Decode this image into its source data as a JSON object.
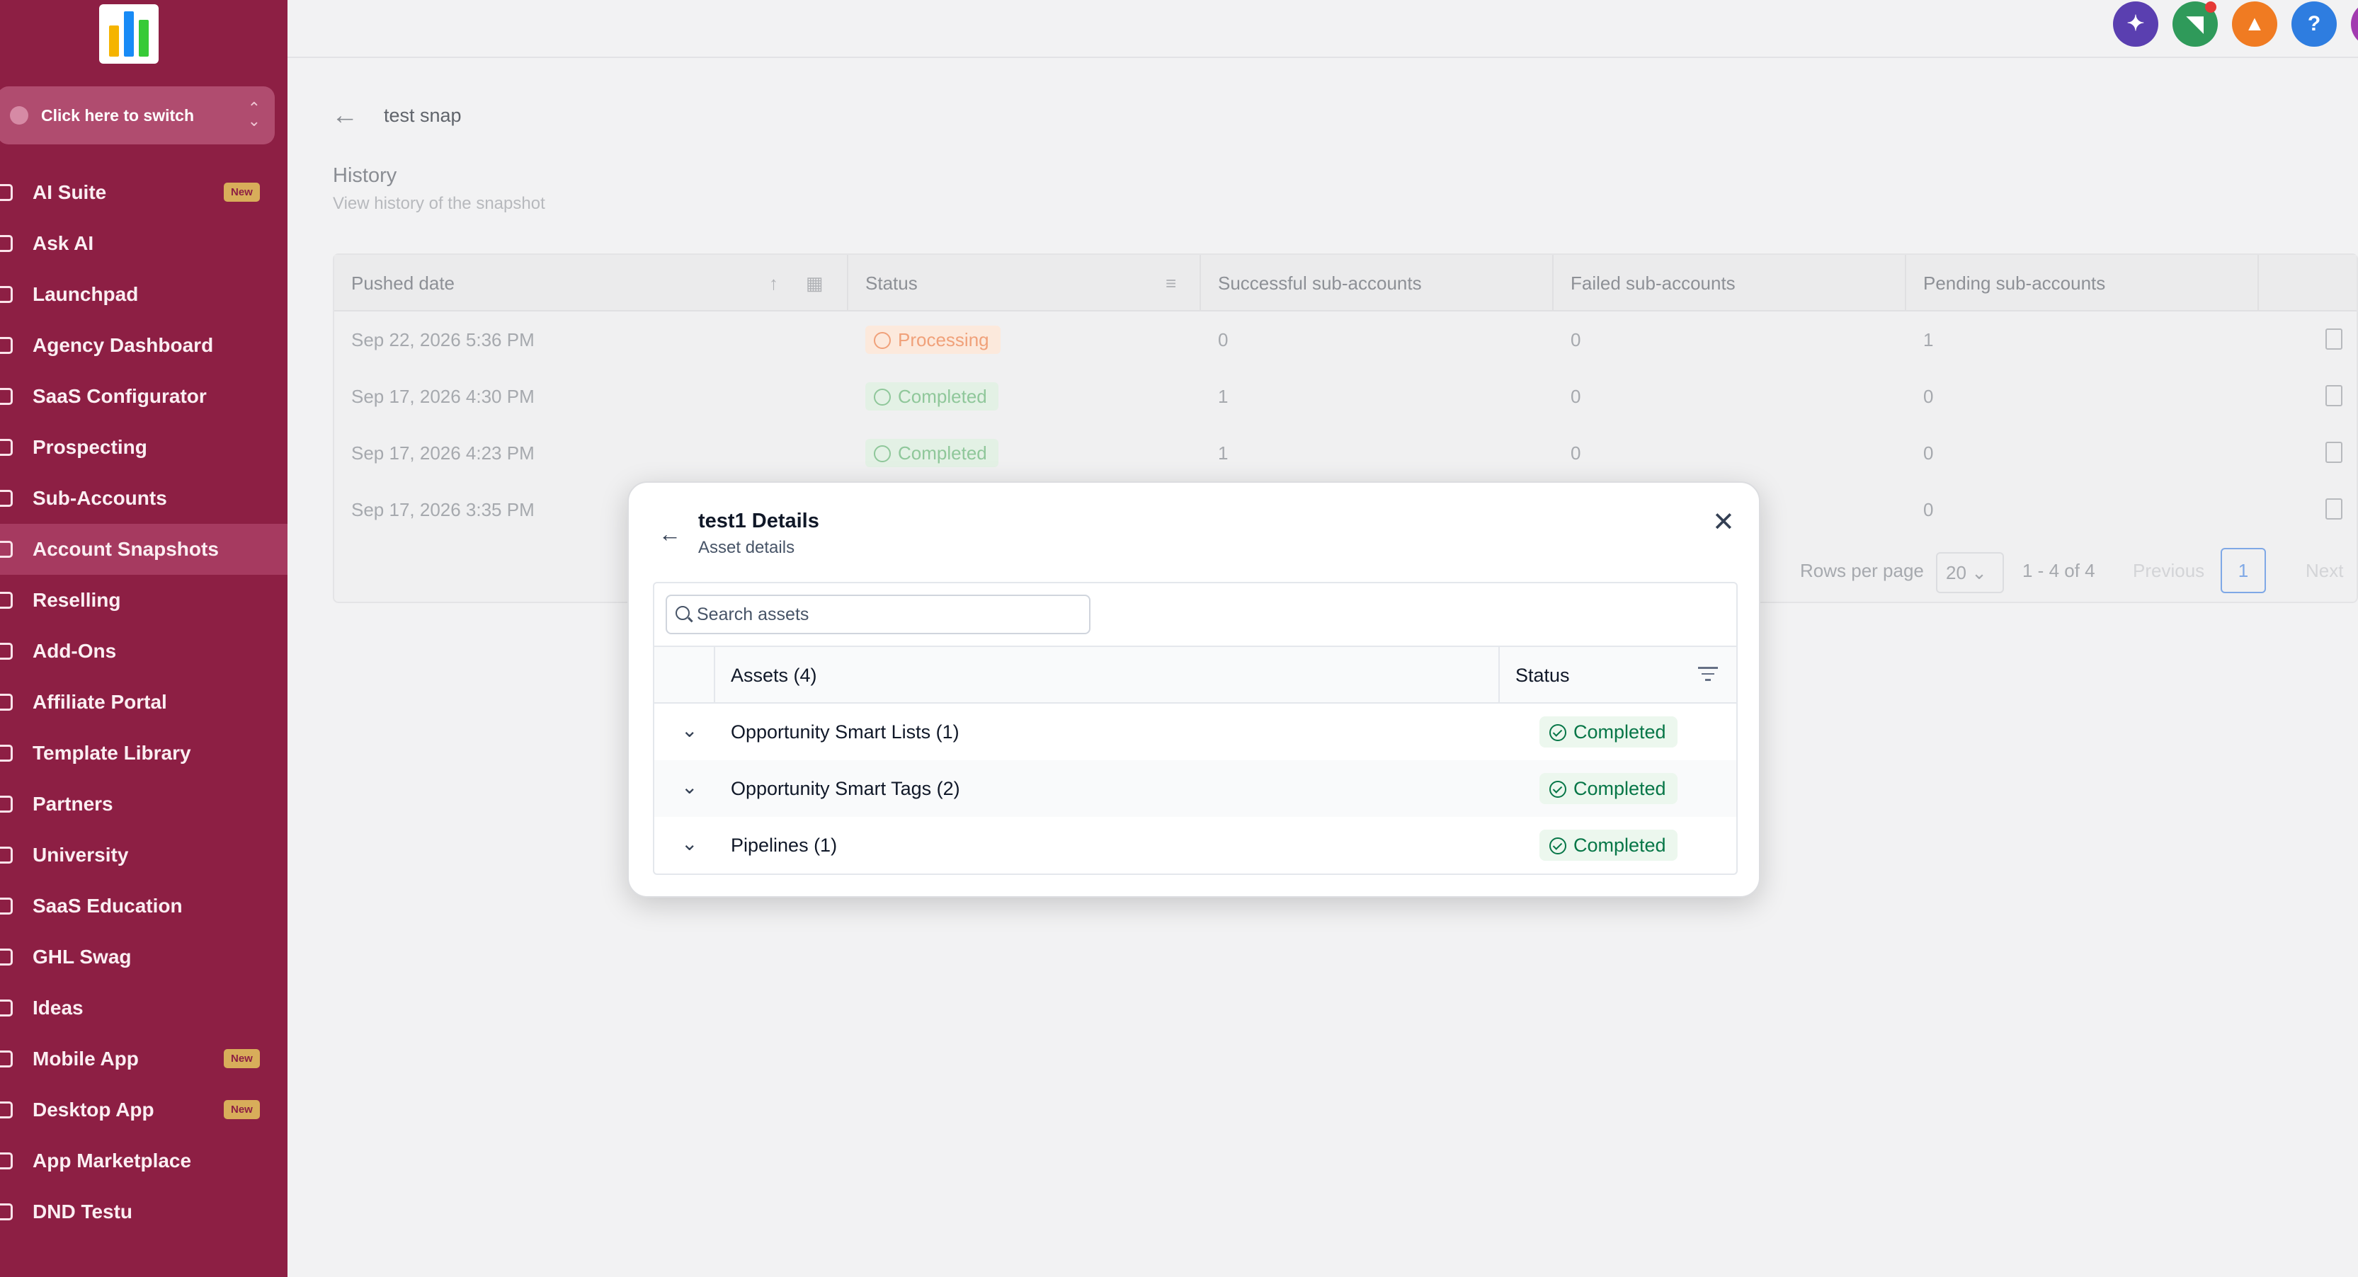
{
  "sidebar": {
    "switcher_label": "Click here to switch",
    "items": [
      {
        "label": "AI Suite",
        "badge": "New",
        "active": false
      },
      {
        "label": "Ask AI",
        "badge": "",
        "active": false
      },
      {
        "label": "Launchpad",
        "badge": "",
        "active": false
      },
      {
        "label": "Agency Dashboard",
        "badge": "",
        "active": false
      },
      {
        "label": "SaaS Configurator",
        "badge": "",
        "active": false
      },
      {
        "label": "Prospecting",
        "badge": "",
        "active": false
      },
      {
        "label": "Sub-Accounts",
        "badge": "",
        "active": false
      },
      {
        "label": "Account Snapshots",
        "badge": "",
        "active": true
      },
      {
        "label": "Reselling",
        "badge": "",
        "active": false
      },
      {
        "label": "Add-Ons",
        "badge": "",
        "active": false
      },
      {
        "label": "Affiliate Portal",
        "badge": "",
        "active": false
      },
      {
        "label": "Template Library",
        "badge": "",
        "active": false
      },
      {
        "label": "Partners",
        "badge": "",
        "active": false
      },
      {
        "label": "University",
        "badge": "",
        "active": false
      },
      {
        "label": "SaaS Education",
        "badge": "",
        "active": false
      },
      {
        "label": "GHL Swag",
        "badge": "",
        "active": false
      },
      {
        "label": "Ideas",
        "badge": "",
        "active": false
      },
      {
        "label": "Mobile App",
        "badge": "New",
        "active": false
      },
      {
        "label": "Desktop App",
        "badge": "New",
        "active": false
      },
      {
        "label": "App Marketplace",
        "badge": "",
        "active": false
      },
      {
        "label": "DND Testu",
        "badge": "",
        "active": false
      }
    ]
  },
  "topbar": {
    "icons": [
      "ai-sparkle-icon",
      "megaphone-icon",
      "bell-icon",
      "help-icon",
      "avatar-icon"
    ],
    "help_glyph": "?"
  },
  "page": {
    "title": "test snap",
    "history_title": "History",
    "history_subtitle": "View history of the snapshot",
    "table": {
      "headers": [
        "Pushed date",
        "Status",
        "Successful sub-accounts",
        "Failed sub-accounts",
        "Pending sub-accounts"
      ],
      "rows": [
        {
          "date": "Sep 22, 2026 5:36 PM",
          "status": "Processing",
          "success": "0",
          "failed": "0",
          "pending": "1"
        },
        {
          "date": "Sep 17, 2026 4:30 PM",
          "status": "Completed",
          "success": "1",
          "failed": "0",
          "pending": "0"
        },
        {
          "date": "Sep 17, 2026 4:23 PM",
          "status": "Completed",
          "success": "1",
          "failed": "0",
          "pending": "0"
        },
        {
          "date": "Sep 17, 2026 3:35 PM",
          "status": "",
          "success": "",
          "failed": "",
          "pending": "0"
        }
      ]
    },
    "pagination": {
      "rows_per_page_label": "Rows per page",
      "rows_per_page_value": "20",
      "range": "1 - 4 of 4",
      "previous": "Previous",
      "current_page": "1",
      "next": "Next"
    }
  },
  "modal": {
    "title": "test1 Details",
    "subtitle": "Asset details",
    "search_placeholder": "Search assets",
    "search_value": "",
    "headers": {
      "assets": "Assets (4)",
      "status": "Status"
    },
    "rows": [
      {
        "asset": "Opportunity Smart Lists (1)",
        "status": "Completed"
      },
      {
        "asset": "Opportunity Smart Tags (2)",
        "status": "Completed"
      },
      {
        "asset": "Pipelines (1)",
        "status": "Completed"
      }
    ]
  },
  "colors": {
    "sidebar": "#8d1f44",
    "completed_text": "#067647",
    "completed_bg": "#ecf7ee",
    "processing_text": "#f0a17a"
  }
}
